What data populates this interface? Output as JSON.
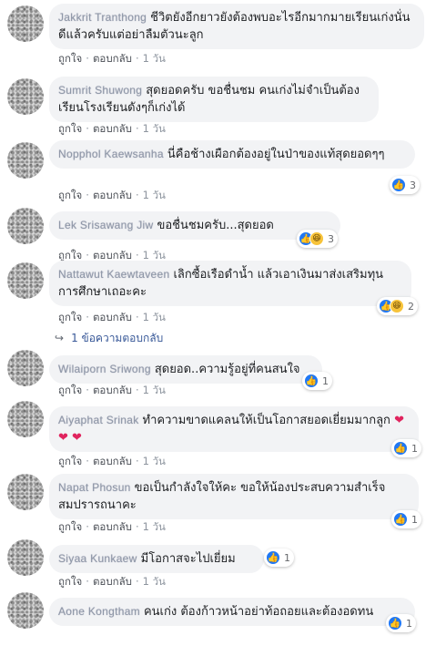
{
  "actions": {
    "like": "ถูกใจ",
    "reply": "ตอบกลับ",
    "time": "1 วัน"
  },
  "comments": [
    {
      "author": "Jakkrit Tranthong",
      "text": "ชีวิตยังอีกยาวยังต้องพบอะไรอีกมากมายเรียนเก่งนั่นดีแล้วครับแต่อย่าลืมตัวนะลูก",
      "reactions": ""
    },
    {
      "author": "Sumrit Shuwong",
      "text": "สุดยอดครับ ขอชื่นชม คนเก่งไม่จำเป็นต้องเรียนโรงเรียนดังๆก็เก่งได้",
      "reactions": ""
    },
    {
      "author": "Nopphol Kaewsanha",
      "text": "นี่คือช้างเผือกต้องอยู่ในป่าของแท้สุดยอดๆๆ",
      "reactions": "3"
    },
    {
      "author": "Lek Srisawang Jiw",
      "text": "ขอชื่นชมครับ...สุดยอด",
      "reactions": "3"
    },
    {
      "author": "Nattawut Kaewtaveen",
      "text": "เลิกซื้อเรือดำน้ำ แล้วเอาเงินมาส่งเสริมทุนการศึกษาเถอะคะ",
      "reactions": "2"
    },
    {
      "author": "Wilaiporn Sriwong",
      "text": "สุดยอด..ความรู้อยู่ที่คนสนใจ",
      "reactions": "1"
    },
    {
      "author": "Aiyaphat Srinak",
      "text": "ทำความขาดแคลนให้เป็นโอกาสยอดเยี่ยมมากลูก",
      "hearts": "❤ ❤ ❤",
      "reactions": "1"
    },
    {
      "author": "Napat Phosun",
      "text": "ขอเป็นกำลังใจให้คะ ขอให้น้องประสบความสำเร็จสมปรารถนาคะ",
      "reactions": "1"
    },
    {
      "author": "Siyaa Kunkaew",
      "text": "มีโอกาสจะไปเยี่ยม",
      "reactions": "1"
    },
    {
      "author": "Aone Kongtham",
      "text": "คนเก่ง ต้องก้าวหน้าอย่าท้อถอยและต้องอดทน",
      "reactions": "1"
    }
  ],
  "reply_thread": {
    "label": "1 ข้อความตอบกลับ"
  },
  "colors": {
    "bubble": "#f2f3f5",
    "like": "#2078f4",
    "haha": "#f7c33a",
    "link": "#385898"
  }
}
